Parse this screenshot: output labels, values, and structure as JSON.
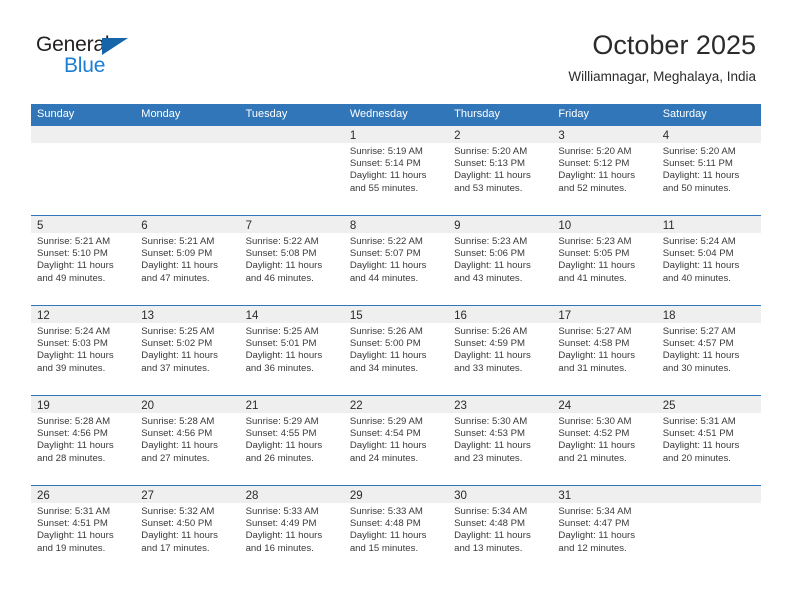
{
  "brand": {
    "name_part1": "General",
    "name_part2": "Blue",
    "triangle_color": "#1565a8",
    "blue_color": "#1c7fd4"
  },
  "header": {
    "month_title": "October 2025",
    "location": "Williamnagar, Meghalaya, India"
  },
  "calendar": {
    "header_color": "#3176b8",
    "daynum_band_color": "#efefef",
    "weekdays": [
      "Sunday",
      "Monday",
      "Tuesday",
      "Wednesday",
      "Thursday",
      "Friday",
      "Saturday"
    ],
    "weeks": [
      [
        {
          "day": "",
          "sunrise": "",
          "sunset": "",
          "daylight1": "",
          "daylight2": ""
        },
        {
          "day": "",
          "sunrise": "",
          "sunset": "",
          "daylight1": "",
          "daylight2": ""
        },
        {
          "day": "",
          "sunrise": "",
          "sunset": "",
          "daylight1": "",
          "daylight2": ""
        },
        {
          "day": "1",
          "sunrise": "Sunrise: 5:19 AM",
          "sunset": "Sunset: 5:14 PM",
          "daylight1": "Daylight: 11 hours",
          "daylight2": "and 55 minutes."
        },
        {
          "day": "2",
          "sunrise": "Sunrise: 5:20 AM",
          "sunset": "Sunset: 5:13 PM",
          "daylight1": "Daylight: 11 hours",
          "daylight2": "and 53 minutes."
        },
        {
          "day": "3",
          "sunrise": "Sunrise: 5:20 AM",
          "sunset": "Sunset: 5:12 PM",
          "daylight1": "Daylight: 11 hours",
          "daylight2": "and 52 minutes."
        },
        {
          "day": "4",
          "sunrise": "Sunrise: 5:20 AM",
          "sunset": "Sunset: 5:11 PM",
          "daylight1": "Daylight: 11 hours",
          "daylight2": "and 50 minutes."
        }
      ],
      [
        {
          "day": "5",
          "sunrise": "Sunrise: 5:21 AM",
          "sunset": "Sunset: 5:10 PM",
          "daylight1": "Daylight: 11 hours",
          "daylight2": "and 49 minutes."
        },
        {
          "day": "6",
          "sunrise": "Sunrise: 5:21 AM",
          "sunset": "Sunset: 5:09 PM",
          "daylight1": "Daylight: 11 hours",
          "daylight2": "and 47 minutes."
        },
        {
          "day": "7",
          "sunrise": "Sunrise: 5:22 AM",
          "sunset": "Sunset: 5:08 PM",
          "daylight1": "Daylight: 11 hours",
          "daylight2": "and 46 minutes."
        },
        {
          "day": "8",
          "sunrise": "Sunrise: 5:22 AM",
          "sunset": "Sunset: 5:07 PM",
          "daylight1": "Daylight: 11 hours",
          "daylight2": "and 44 minutes."
        },
        {
          "day": "9",
          "sunrise": "Sunrise: 5:23 AM",
          "sunset": "Sunset: 5:06 PM",
          "daylight1": "Daylight: 11 hours",
          "daylight2": "and 43 minutes."
        },
        {
          "day": "10",
          "sunrise": "Sunrise: 5:23 AM",
          "sunset": "Sunset: 5:05 PM",
          "daylight1": "Daylight: 11 hours",
          "daylight2": "and 41 minutes."
        },
        {
          "day": "11",
          "sunrise": "Sunrise: 5:24 AM",
          "sunset": "Sunset: 5:04 PM",
          "daylight1": "Daylight: 11 hours",
          "daylight2": "and 40 minutes."
        }
      ],
      [
        {
          "day": "12",
          "sunrise": "Sunrise: 5:24 AM",
          "sunset": "Sunset: 5:03 PM",
          "daylight1": "Daylight: 11 hours",
          "daylight2": "and 39 minutes."
        },
        {
          "day": "13",
          "sunrise": "Sunrise: 5:25 AM",
          "sunset": "Sunset: 5:02 PM",
          "daylight1": "Daylight: 11 hours",
          "daylight2": "and 37 minutes."
        },
        {
          "day": "14",
          "sunrise": "Sunrise: 5:25 AM",
          "sunset": "Sunset: 5:01 PM",
          "daylight1": "Daylight: 11 hours",
          "daylight2": "and 36 minutes."
        },
        {
          "day": "15",
          "sunrise": "Sunrise: 5:26 AM",
          "sunset": "Sunset: 5:00 PM",
          "daylight1": "Daylight: 11 hours",
          "daylight2": "and 34 minutes."
        },
        {
          "day": "16",
          "sunrise": "Sunrise: 5:26 AM",
          "sunset": "Sunset: 4:59 PM",
          "daylight1": "Daylight: 11 hours",
          "daylight2": "and 33 minutes."
        },
        {
          "day": "17",
          "sunrise": "Sunrise: 5:27 AM",
          "sunset": "Sunset: 4:58 PM",
          "daylight1": "Daylight: 11 hours",
          "daylight2": "and 31 minutes."
        },
        {
          "day": "18",
          "sunrise": "Sunrise: 5:27 AM",
          "sunset": "Sunset: 4:57 PM",
          "daylight1": "Daylight: 11 hours",
          "daylight2": "and 30 minutes."
        }
      ],
      [
        {
          "day": "19",
          "sunrise": "Sunrise: 5:28 AM",
          "sunset": "Sunset: 4:56 PM",
          "daylight1": "Daylight: 11 hours",
          "daylight2": "and 28 minutes."
        },
        {
          "day": "20",
          "sunrise": "Sunrise: 5:28 AM",
          "sunset": "Sunset: 4:56 PM",
          "daylight1": "Daylight: 11 hours",
          "daylight2": "and 27 minutes."
        },
        {
          "day": "21",
          "sunrise": "Sunrise: 5:29 AM",
          "sunset": "Sunset: 4:55 PM",
          "daylight1": "Daylight: 11 hours",
          "daylight2": "and 26 minutes."
        },
        {
          "day": "22",
          "sunrise": "Sunrise: 5:29 AM",
          "sunset": "Sunset: 4:54 PM",
          "daylight1": "Daylight: 11 hours",
          "daylight2": "and 24 minutes."
        },
        {
          "day": "23",
          "sunrise": "Sunrise: 5:30 AM",
          "sunset": "Sunset: 4:53 PM",
          "daylight1": "Daylight: 11 hours",
          "daylight2": "and 23 minutes."
        },
        {
          "day": "24",
          "sunrise": "Sunrise: 5:30 AM",
          "sunset": "Sunset: 4:52 PM",
          "daylight1": "Daylight: 11 hours",
          "daylight2": "and 21 minutes."
        },
        {
          "day": "25",
          "sunrise": "Sunrise: 5:31 AM",
          "sunset": "Sunset: 4:51 PM",
          "daylight1": "Daylight: 11 hours",
          "daylight2": "and 20 minutes."
        }
      ],
      [
        {
          "day": "26",
          "sunrise": "Sunrise: 5:31 AM",
          "sunset": "Sunset: 4:51 PM",
          "daylight1": "Daylight: 11 hours",
          "daylight2": "and 19 minutes."
        },
        {
          "day": "27",
          "sunrise": "Sunrise: 5:32 AM",
          "sunset": "Sunset: 4:50 PM",
          "daylight1": "Daylight: 11 hours",
          "daylight2": "and 17 minutes."
        },
        {
          "day": "28",
          "sunrise": "Sunrise: 5:33 AM",
          "sunset": "Sunset: 4:49 PM",
          "daylight1": "Daylight: 11 hours",
          "daylight2": "and 16 minutes."
        },
        {
          "day": "29",
          "sunrise": "Sunrise: 5:33 AM",
          "sunset": "Sunset: 4:48 PM",
          "daylight1": "Daylight: 11 hours",
          "daylight2": "and 15 minutes."
        },
        {
          "day": "30",
          "sunrise": "Sunrise: 5:34 AM",
          "sunset": "Sunset: 4:48 PM",
          "daylight1": "Daylight: 11 hours",
          "daylight2": "and 13 minutes."
        },
        {
          "day": "31",
          "sunrise": "Sunrise: 5:34 AM",
          "sunset": "Sunset: 4:47 PM",
          "daylight1": "Daylight: 11 hours",
          "daylight2": "and 12 minutes."
        },
        {
          "day": "",
          "sunrise": "",
          "sunset": "",
          "daylight1": "",
          "daylight2": ""
        }
      ]
    ]
  }
}
